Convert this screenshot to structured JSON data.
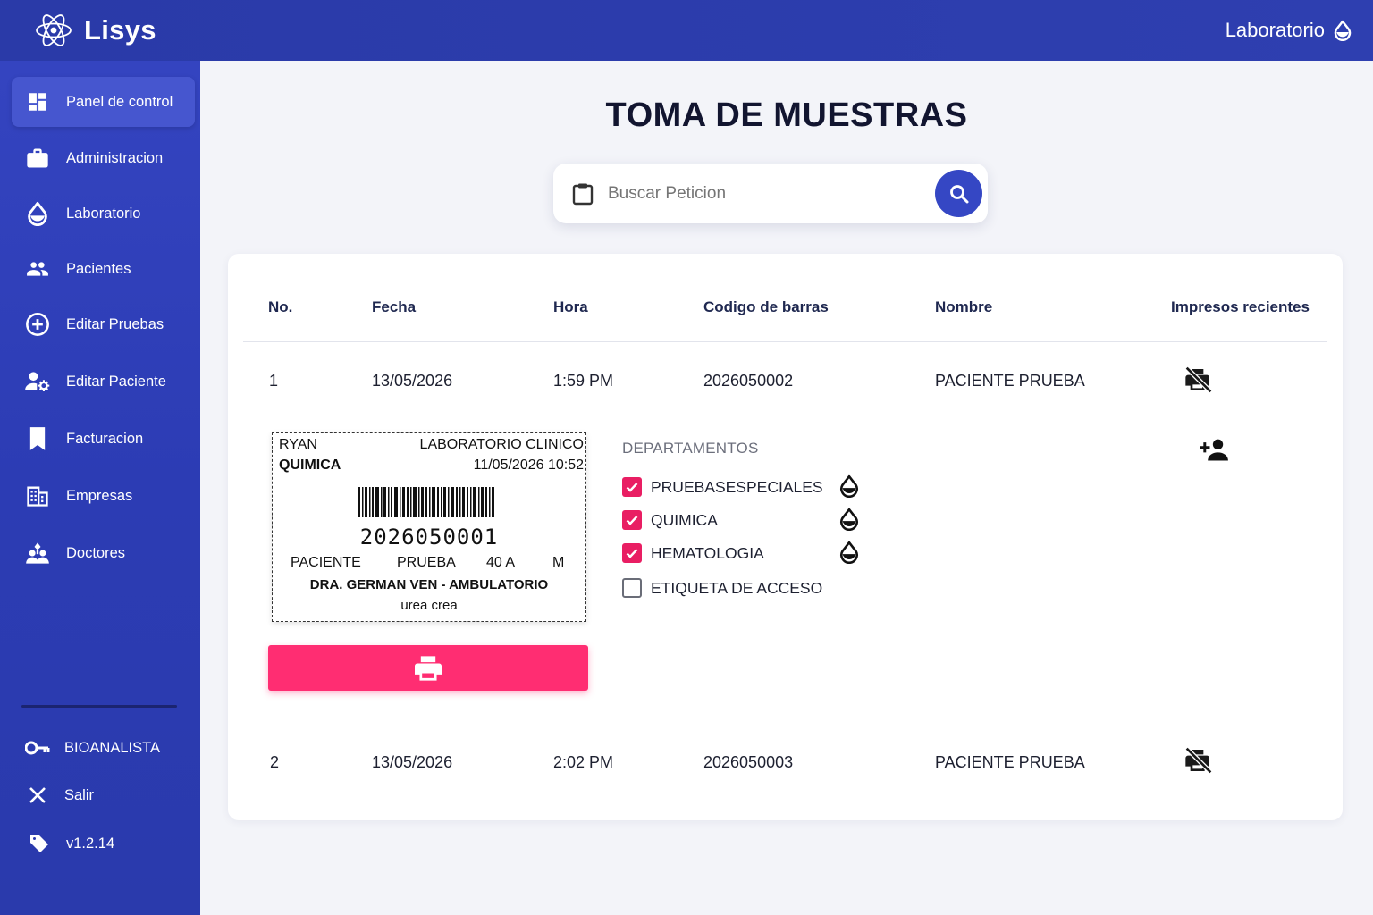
{
  "app": {
    "name": "Lisys",
    "module": "Laboratorio"
  },
  "sidebar": {
    "items": [
      {
        "label": "Panel de control",
        "icon": "dashboard-icon",
        "active": true
      },
      {
        "label": "Administracion",
        "icon": "briefcase-icon"
      },
      {
        "label": "Laboratorio",
        "icon": "drop-icon"
      },
      {
        "label": "Pacientes",
        "icon": "people-icon"
      },
      {
        "label": "Editar Pruebas",
        "icon": "add-circle-icon"
      },
      {
        "label": "Editar Paciente",
        "icon": "person-settings-icon"
      },
      {
        "label": "Facturacion",
        "icon": "bookmark-icon"
      },
      {
        "label": "Empresas",
        "icon": "building-icon"
      },
      {
        "label": "Doctores",
        "icon": "doctors-icon"
      }
    ],
    "footer": {
      "role": "BIOANALISTA",
      "logout": "Salir",
      "version": "v1.2.14"
    }
  },
  "page": {
    "title": "TOMA DE MUESTRAS"
  },
  "search": {
    "placeholder": "Buscar Peticion"
  },
  "table": {
    "headers": [
      "No.",
      "Fecha",
      "Hora",
      "Codigo de barras",
      "Nombre",
      "Impresos recientes"
    ],
    "rows": [
      {
        "no": "1",
        "fecha": "13/05/2026",
        "hora": "1:59 PM",
        "codigo": "2026050002",
        "nombre": "PACIENTE PRUEBA"
      },
      {
        "no": "2",
        "fecha": "13/05/2026",
        "hora": "2:02 PM",
        "codigo": "2026050003",
        "nombre": "PACIENTE PRUEBA"
      }
    ]
  },
  "label_preview": {
    "user": "RYAN",
    "lab": "LABORATORIO CLINICO",
    "department": "QUIMICA",
    "datetime": "11/05/2026 10:52",
    "barcode": "2026050001",
    "first_name": "PACIENTE",
    "last_name": "PRUEBA",
    "age": "40 A",
    "sex": "M",
    "doctor": "DRA. GERMAN VEN - AMBULATORIO",
    "tests": "urea crea"
  },
  "departments": {
    "title": "DEPARTAMENTOS",
    "items": [
      {
        "label": "PRUEBASESPECIALES",
        "checked": true
      },
      {
        "label": "QUIMICA",
        "checked": true
      },
      {
        "label": "HEMATOLOGIA",
        "checked": true
      },
      {
        "label": "ETIQUETA DE ACCESO",
        "checked": false
      }
    ]
  },
  "colors": {
    "primary": "#2e3fb0",
    "accent": "#ff2d72",
    "checkbox": "#e91e63"
  }
}
